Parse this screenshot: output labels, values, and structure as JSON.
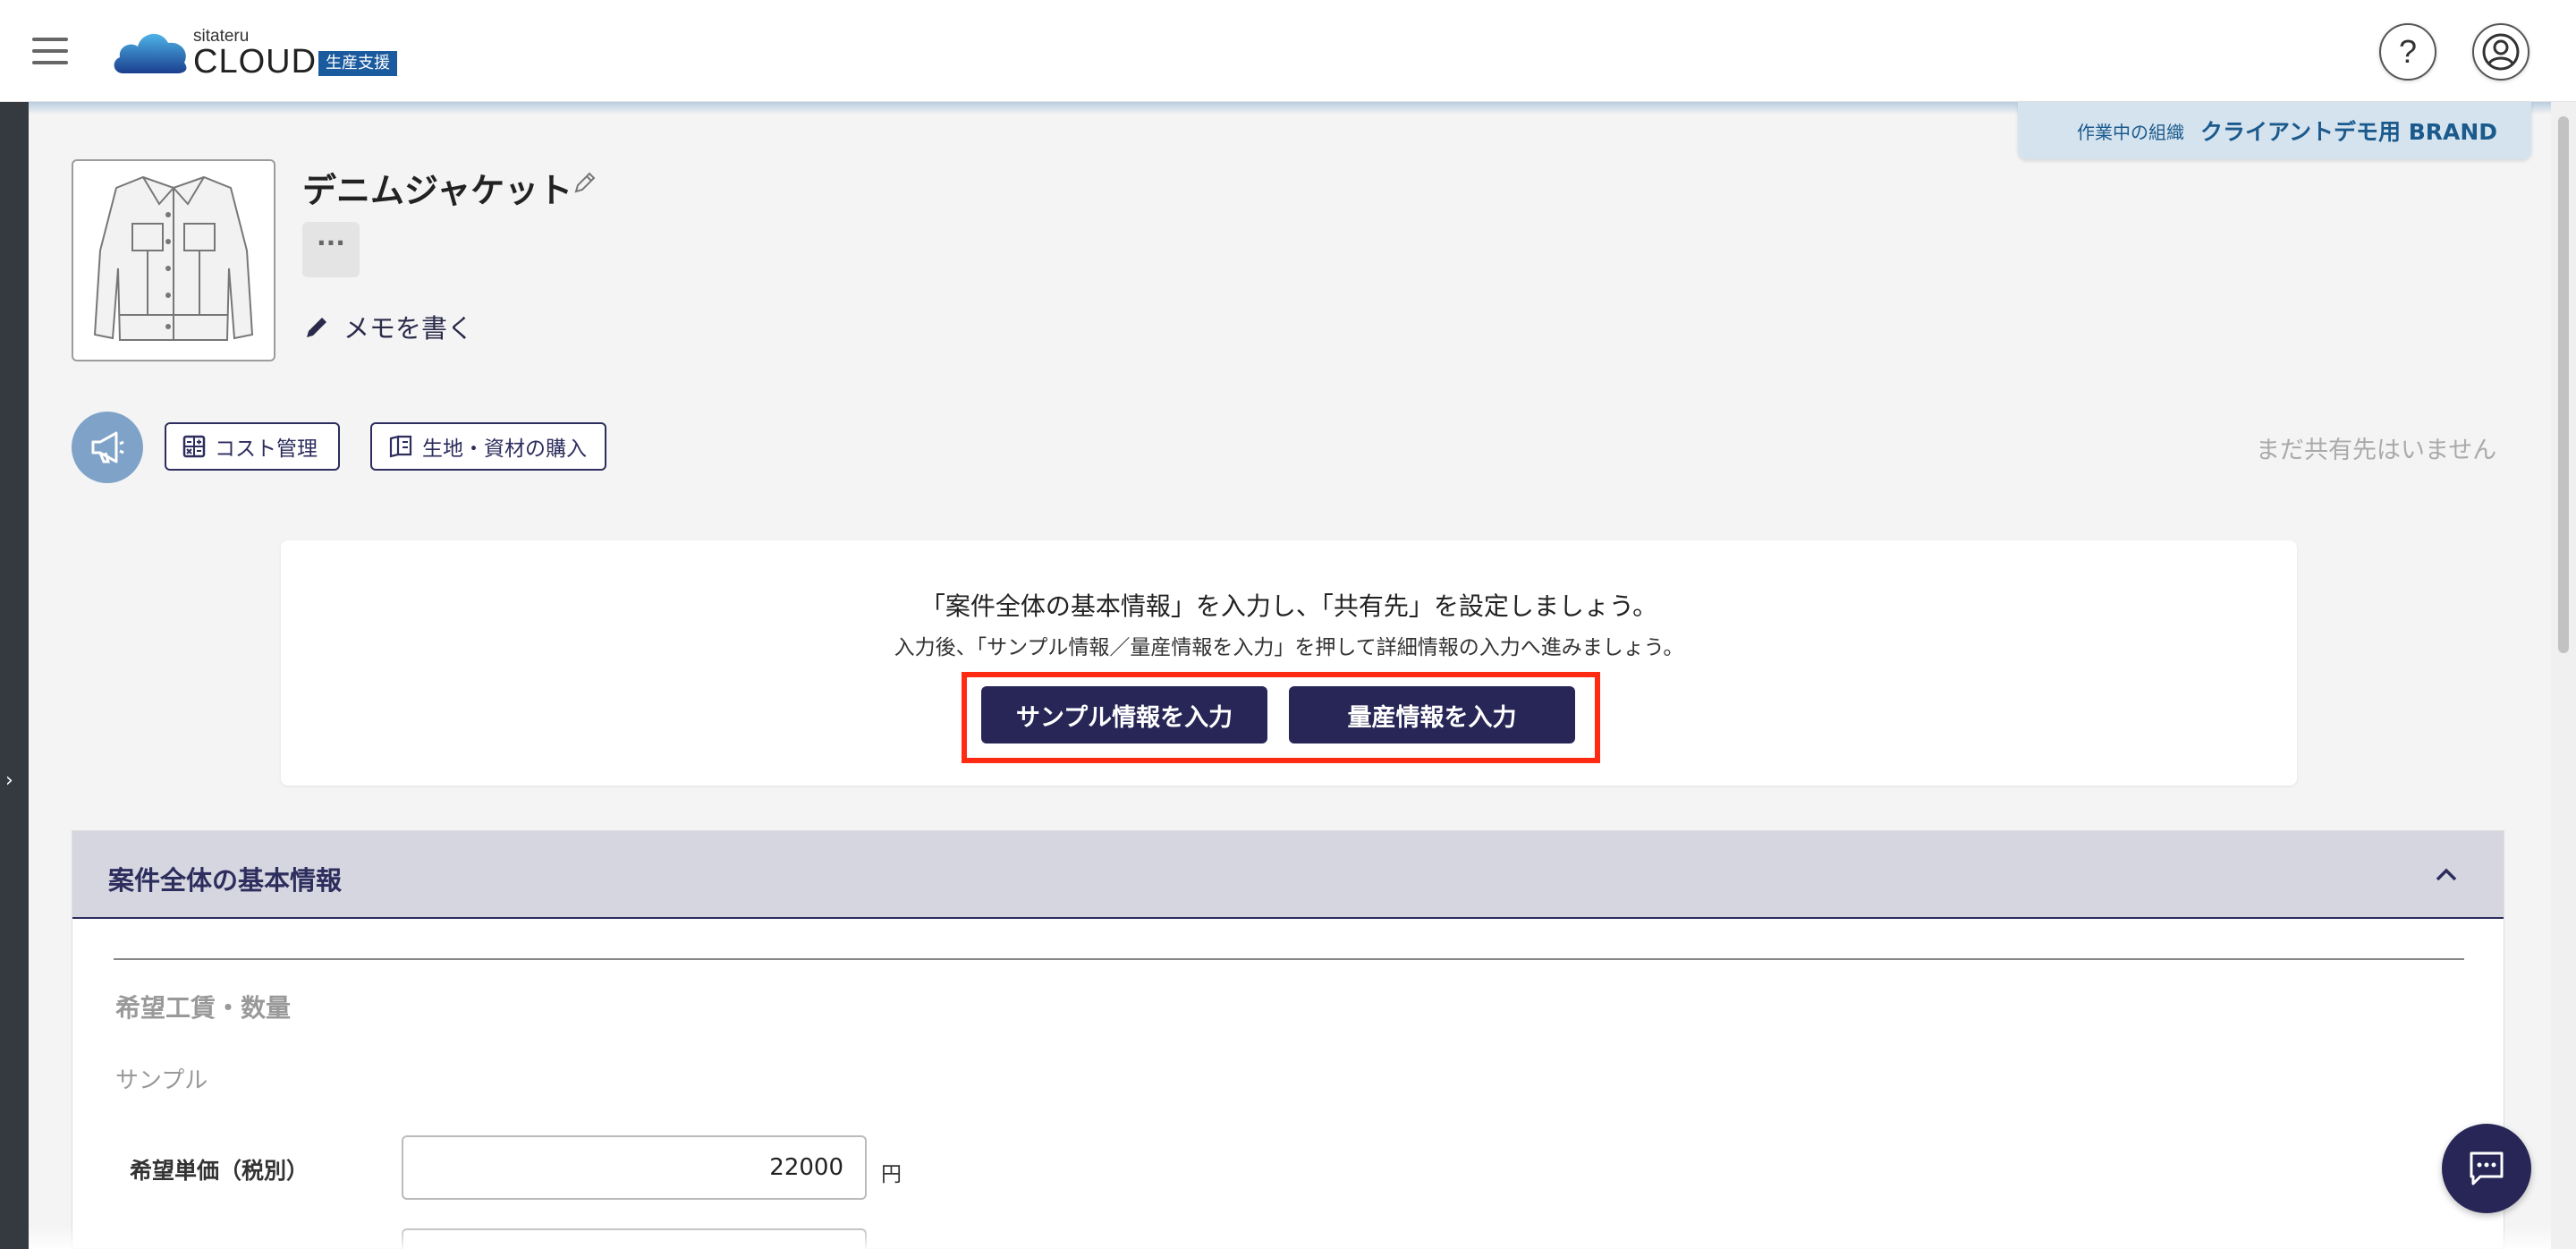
{
  "header": {
    "brand_small": "sitateru",
    "brand_big": "CLOUD",
    "brand_tag": "生産支援",
    "help_label": "?"
  },
  "org": {
    "label": "作業中の組織",
    "name": "クライアントデモ用 BRAND"
  },
  "product": {
    "title": "デニムジャケット",
    "more_label": "···",
    "memo_label": "メモを書く"
  },
  "actions": {
    "cost_label": "コスト管理",
    "fabric_label": "生地・資材の購入",
    "no_share_text": "まだ共有先はいません"
  },
  "notice": {
    "line1": "「案件全体の基本情報」を入力し、「共有先」を設定しましょう。",
    "line2": "入力後、「サンプル情報／量産情報を入力」を押して詳細情報の入力へ進みましょう。",
    "sample_button": "サンプル情報を入力",
    "mass_button": "量産情報を入力"
  },
  "section": {
    "title": "案件全体の基本情報",
    "sub_heading": "希望工賃・数量",
    "sub_label": "サンプル",
    "price_label": "希望単価（税別）",
    "price_value": "22000",
    "unit": "円"
  },
  "colors": {
    "navy": "#272656",
    "highlight": "#ff2a12",
    "org_tab": "#d5e3ef",
    "megaphone": "#7fa3c8"
  }
}
